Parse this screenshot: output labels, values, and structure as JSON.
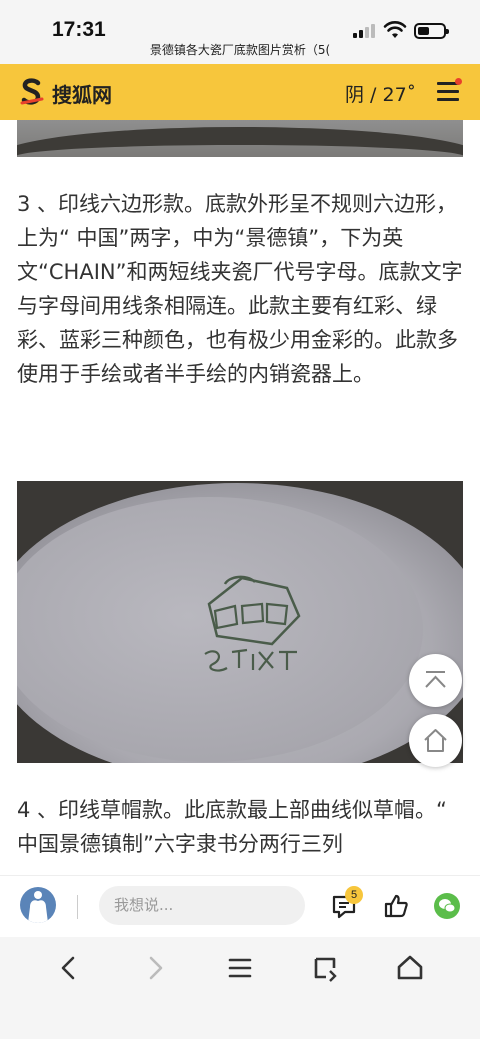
{
  "status": {
    "time": "17:31",
    "page_title": "景德镇各大瓷厂底款图片赏析（5("
  },
  "header": {
    "site_name": "搜狐网",
    "weather": "阴 / 27˚",
    "brand_color": "#f7c63c"
  },
  "article": {
    "paragraph_3": "3 、印线六边形款。底款外形呈不规则六边形， 上为“ 中国”两字，中为“景德镇”，下为英文“CHAIN”和两短线夹瓷厂代号字母。底款文字与字母间用线条相隔连。此款主要有红彩、绿彩、蓝彩三种颜色，也有极少用金彩的。此款多使用于手绘或者半手绘的内销瓷器上。",
    "paragraph_4": "4 、印线草帽款。此底款最上部曲线似草帽。“ 中国景德镇制”六字隶书分两行三列"
  },
  "comment_bar": {
    "placeholder": "我想说...",
    "comment_count": "5"
  },
  "icons": {
    "back_to_top": "arrow-up-icon",
    "home": "home-icon",
    "comments": "comment-icon",
    "like": "thumbs-up-icon",
    "wechat": "wechat-icon",
    "browser_back": "chevron-left-icon",
    "browser_forward": "chevron-right-icon",
    "browser_menu": "menu-icon",
    "browser_tabs": "tabs-icon",
    "browser_home": "home-icon"
  }
}
